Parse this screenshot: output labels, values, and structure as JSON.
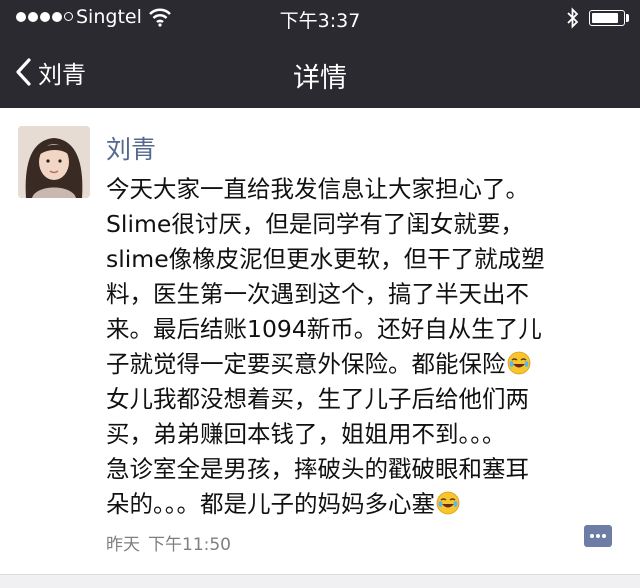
{
  "status_bar": {
    "carrier": "Singtel",
    "time": "下午3:37"
  },
  "nav": {
    "back_label": "刘青",
    "title": "详情"
  },
  "post": {
    "author": "刘青",
    "lines": [
      "今天大家一直给我发信息让大家担心了。",
      "Slime很讨厌，但是同学有了闺女就要，",
      "slime像橡皮泥但更水更软，但干了就成塑",
      "料，医生第一次遇到这个，搞了半天出不",
      "来。最后结账1094新币。还好自从生了儿",
      "子就觉得一定要买意外保险。都能保险",
      "女儿我都没想着买，生了儿子后给他们两",
      "买，弟弟赚回本钱了，姐姐用不到。。。",
      "急诊室全是男孩，摔破头的戳破眼和塞耳",
      "朵的。。。都是儿子的妈妈多心塞"
    ],
    "emoji_icon": "crying-laughing-emoji",
    "date_label": "昨天",
    "time_label": "下午11:50"
  },
  "colors": {
    "nav_bg": "#2b2a30",
    "author": "#55698f",
    "comment_button": "#6d7da6"
  }
}
